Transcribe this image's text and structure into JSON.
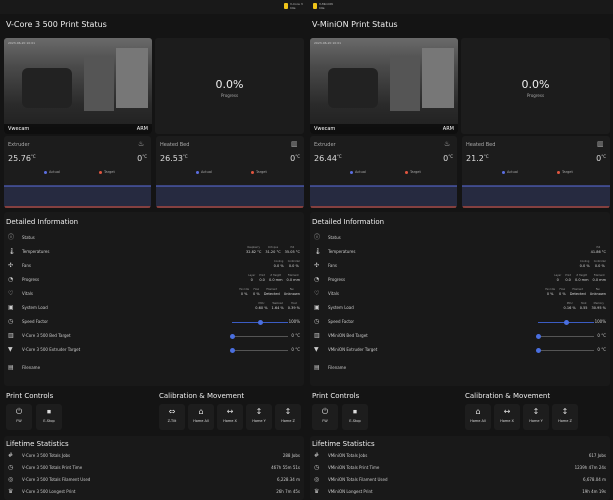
{
  "topbar": {
    "entity1": {
      "title": "V-Core 3",
      "sub": "Idle"
    },
    "entity2": {
      "title": "V-MiniON",
      "sub": "Idle"
    }
  },
  "left": {
    "title": "V-Core 3 500 Print Status",
    "camera": {
      "name": "Vwecam",
      "brand": "ARM",
      "timestamp": "2023-06-20 10:01"
    },
    "progress": {
      "value": "0.0%",
      "label": "Progress"
    },
    "extruder": {
      "name": "Extruder",
      "actual": "25.76",
      "target": "0",
      "unit": "°C",
      "legend_actual": "Actual",
      "legend_target": "Target"
    },
    "bed": {
      "name": "Heated Bed",
      "actual": "26.53",
      "target": "0",
      "unit": "°C",
      "legend_actual": "Actual",
      "legend_target": "Target"
    },
    "details": {
      "title": "Detailed Information",
      "status": "Status",
      "temperatures": {
        "label": "Temperatures",
        "cols": [
          {
            "h": "Raspberry",
            "v": "32.82 °C"
          },
          {
            "h": "Octopus",
            "v": "31.20 °C"
          },
          {
            "h": "Pi4",
            "v": "35.05 °C"
          }
        ]
      },
      "fans": {
        "label": "Fans",
        "cols": [
          {
            "h": "Cooling",
            "v": "0.0 %"
          },
          {
            "h": "Controller",
            "v": "0.0 %"
          }
        ]
      },
      "progress": {
        "label": "Progress",
        "cols": [
          {
            "h": "Layer",
            "v": "0"
          },
          {
            "h": "Print",
            "v": "0.0"
          },
          {
            "h": "Z Height",
            "v": "0.0 mm"
          },
          {
            "h": "Filament",
            "v": "0.0 mm"
          }
        ]
      },
      "vitals": {
        "label": "Vitals",
        "cols": [
          {
            "h": "Fan Idle",
            "v": "0 %"
          },
          {
            "h": "Flow",
            "v": "0 %"
          },
          {
            "h": "Filament",
            "v": "Detected"
          },
          {
            "h": "Fan",
            "v": "Unknown"
          }
        ]
      },
      "system_load": {
        "label": "System Load",
        "cols": [
          {
            "h": "MCU",
            "v": "0.60 %"
          },
          {
            "h": "Taskload",
            "v": "1.64 %"
          },
          {
            "h": "Host",
            "v": "0.39 %"
          }
        ]
      },
      "speed_factor": {
        "label": "Speed Factor",
        "value": "100%"
      },
      "bed_target": {
        "label": "V-Core 3 500 Bed Target",
        "value": "0 °C"
      },
      "extruder_target": {
        "label": "V-Core 3 500 Extruder Target",
        "value": "0 °C"
      },
      "filename": "Filename"
    },
    "controls": {
      "title": "Print Controls",
      "calib_title": "Calibration & Movement",
      "buttons": [
        {
          "icon": "power-icon",
          "label": "FW"
        },
        {
          "icon": "stop-icon",
          "label": "E-Stop"
        }
      ],
      "calib_buttons": [
        {
          "icon": "tilt-icon",
          "label": "Z-Tilt"
        },
        {
          "icon": "home-icon",
          "label": "Home All"
        },
        {
          "icon": "arrows-h-icon",
          "label": "Home X"
        },
        {
          "icon": "arrows-v-icon",
          "label": "Home Y"
        },
        {
          "icon": "arrows-v-icon",
          "label": "Home Z"
        }
      ]
    },
    "lifetime": {
      "title": "Lifetime Statistics",
      "rows": [
        {
          "label": "V-Core 3 500 Totals Jobs",
          "value": "288 Jobs"
        },
        {
          "label": "V-Core 3 500 Totals Print Time",
          "value": "467h 55m 51s"
        },
        {
          "label": "V-Core 3 500 Totals Filament Used",
          "value": "6,228.34 m"
        },
        {
          "label": "V-Core 3 500 Longest Print",
          "value": "26h 7m 45s"
        }
      ]
    }
  },
  "right": {
    "title": "V-MiniON Print Status",
    "camera": {
      "name": "Vwecam",
      "brand": "ARM",
      "timestamp": "2023-06-20 10:01"
    },
    "progress": {
      "value": "0.0%",
      "label": "Progress"
    },
    "extruder": {
      "name": "Extruder",
      "actual": "26.44",
      "target": "0",
      "unit": "°C",
      "legend_actual": "Actual",
      "legend_target": "Target"
    },
    "bed": {
      "name": "Heated Bed",
      "actual": "21.2",
      "target": "0",
      "unit": "°C",
      "legend_actual": "Actual",
      "legend_target": "Target"
    },
    "details": {
      "title": "Detailed Information",
      "status": "Status",
      "temperatures": {
        "label": "Temperatures",
        "cols": [
          {
            "h": "Pi4",
            "v": "41.86 °C"
          }
        ]
      },
      "fans": {
        "label": "Fans",
        "cols": [
          {
            "h": "Cooling",
            "v": "0.0 %"
          },
          {
            "h": "Controller",
            "v": "0.0 %"
          }
        ]
      },
      "progress": {
        "label": "Progress",
        "cols": [
          {
            "h": "Layer",
            "v": "0"
          },
          {
            "h": "Print",
            "v": "0.0"
          },
          {
            "h": "Z Height",
            "v": "0.0 mm"
          },
          {
            "h": "Filament",
            "v": "0.0 mm"
          }
        ]
      },
      "vitals": {
        "label": "Vitals",
        "cols": [
          {
            "h": "Fan Idle",
            "v": "0 %"
          },
          {
            "h": "Flow",
            "v": "0 %"
          },
          {
            "h": "Filament",
            "v": "Detected"
          },
          {
            "h": "Fan",
            "v": "Unknown"
          }
        ]
      },
      "system_load": {
        "label": "System Load",
        "cols": [
          {
            "h": "MCU",
            "v": "0.16 %"
          },
          {
            "h": "Host",
            "v": "0.55"
          },
          {
            "h": "Memory",
            "v": "30.95 %"
          }
        ]
      },
      "speed_factor": {
        "label": "Speed Factor",
        "value": "100%"
      },
      "bed_target": {
        "label": "VMiniON Bed Target",
        "value": "0 °C"
      },
      "extruder_target": {
        "label": "VMiniON Extruder Target",
        "value": "0 °C"
      },
      "filename": "Filename"
    },
    "controls": {
      "title": "Print Controls",
      "calib_title": "Calibration & Movement",
      "buttons": [
        {
          "icon": "power-icon",
          "label": "FW"
        },
        {
          "icon": "stop-icon",
          "label": "E-Stop"
        }
      ],
      "calib_buttons": [
        {
          "icon": "home-icon",
          "label": "Home All"
        },
        {
          "icon": "arrows-h-icon",
          "label": "Home X"
        },
        {
          "icon": "arrows-v-icon",
          "label": "Home Y"
        },
        {
          "icon": "arrows-v-icon",
          "label": "Home Z"
        }
      ]
    },
    "lifetime": {
      "title": "Lifetime Statistics",
      "rows": [
        {
          "label": "VMiniON Totals Jobs",
          "value": "617 Jobs"
        },
        {
          "label": "VMiniON Totals Print Time",
          "value": "1239h 47m 24s"
        },
        {
          "label": "VMiniON Totals Filament Used",
          "value": "6,678.04 m"
        },
        {
          "label": "VMiniON Longest Print",
          "value": "19h 4m 19s"
        }
      ]
    }
  },
  "colors": {
    "actual": "#5b6ee1",
    "target": "#e1553f",
    "accent": "#4a6fe0"
  }
}
